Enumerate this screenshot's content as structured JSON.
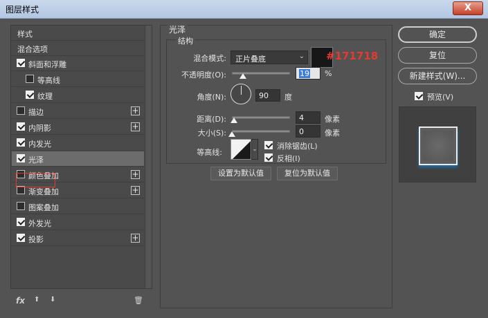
{
  "window": {
    "title": "图层样式",
    "close_glyph": "X"
  },
  "left_panel": {
    "header": "样式",
    "blend_options": "混合选项",
    "items": [
      {
        "label": "斜面和浮雕",
        "checked": true,
        "plus": false
      },
      {
        "label": "等高线",
        "checked": false,
        "plus": false,
        "indent": true
      },
      {
        "label": "纹理",
        "checked": true,
        "plus": false,
        "indent": true
      },
      {
        "label": "描边",
        "checked": false,
        "plus": true
      },
      {
        "label": "内阴影",
        "checked": true,
        "plus": true
      },
      {
        "label": "内发光",
        "checked": true,
        "plus": false
      },
      {
        "label": "光泽",
        "checked": true,
        "plus": false,
        "selected": true
      },
      {
        "label": "颜色叠加",
        "checked": false,
        "plus": true
      },
      {
        "label": "渐变叠加",
        "checked": false,
        "plus": true
      },
      {
        "label": "图案叠加",
        "checked": false,
        "plus": false
      },
      {
        "label": "外发光",
        "checked": true,
        "plus": false
      },
      {
        "label": "投影",
        "checked": true,
        "plus": true
      }
    ],
    "plus_glyph": "+",
    "bottom": {
      "fx": "fx",
      "up": "⬆",
      "down": "⬇",
      "trash": "🗑"
    }
  },
  "satin": {
    "group_title": "光泽",
    "section_title": "结构",
    "blend_mode_label": "混合模式:",
    "blend_mode_value": "正片叠底",
    "color_hex": "#171718",
    "opacity_label": "不透明度(O):",
    "opacity_value": "19",
    "opacity_unit": "%",
    "angle_label": "角度(N):",
    "angle_value": "90",
    "angle_unit": "度",
    "distance_label": "距离(D):",
    "distance_value": "4",
    "distance_unit": "像素",
    "size_label": "大小(S):",
    "size_value": "0",
    "size_unit": "像素",
    "contour_label": "等高线:",
    "antialias_label": "消除锯齿(L)",
    "antialias_checked": true,
    "invert_label": "反相(I)",
    "invert_checked": true,
    "set_default": "设置为默认值",
    "reset_default": "复位为默认值",
    "opacity_fraction": 0.19,
    "distance_fraction": 0.04,
    "size_fraction": 0.0
  },
  "right_panel": {
    "ok": "确定",
    "reset": "复位",
    "new_style": "新建样式(W)...",
    "preview_label": "预览(V)",
    "preview_checked": true
  }
}
